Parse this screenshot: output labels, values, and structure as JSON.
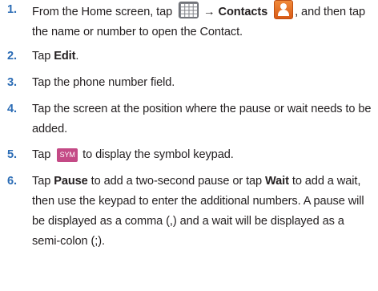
{
  "steps": [
    {
      "num": "1.",
      "t1": "From the Home screen, tap ",
      "arrow": " → ",
      "contacts": "Contacts",
      "t2": ", and then tap the name or number to open the Contact."
    },
    {
      "num": "2.",
      "t1": "Tap ",
      "bold": "Edit",
      "t2": "."
    },
    {
      "num": "3.",
      "text": "Tap the phone number field."
    },
    {
      "num": "4.",
      "text": "Tap the screen at the position where the pause or wait needs to be added."
    },
    {
      "num": "5.",
      "t1": "Tap ",
      "key": "SYM",
      "t2": " to display the symbol keypad."
    },
    {
      "num": "6.",
      "t1": "Tap ",
      "b1": "Pause",
      "t2": " to add a two-second pause or tap ",
      "b2": "Wait",
      "t3": " to add a wait, then use the keypad to enter the additional numbers. A pause will be displayed as a comma (,) and a wait will be displayed as a semi-colon (;)."
    }
  ],
  "icons": {
    "apps": "apps-grid-icon",
    "contacts": "contacts-person-icon",
    "sym": "sym-key-icon"
  },
  "colors": {
    "step_number": "#2b6cb5",
    "contacts_icon": "#e8742a",
    "sym_key": "#c44a86"
  }
}
